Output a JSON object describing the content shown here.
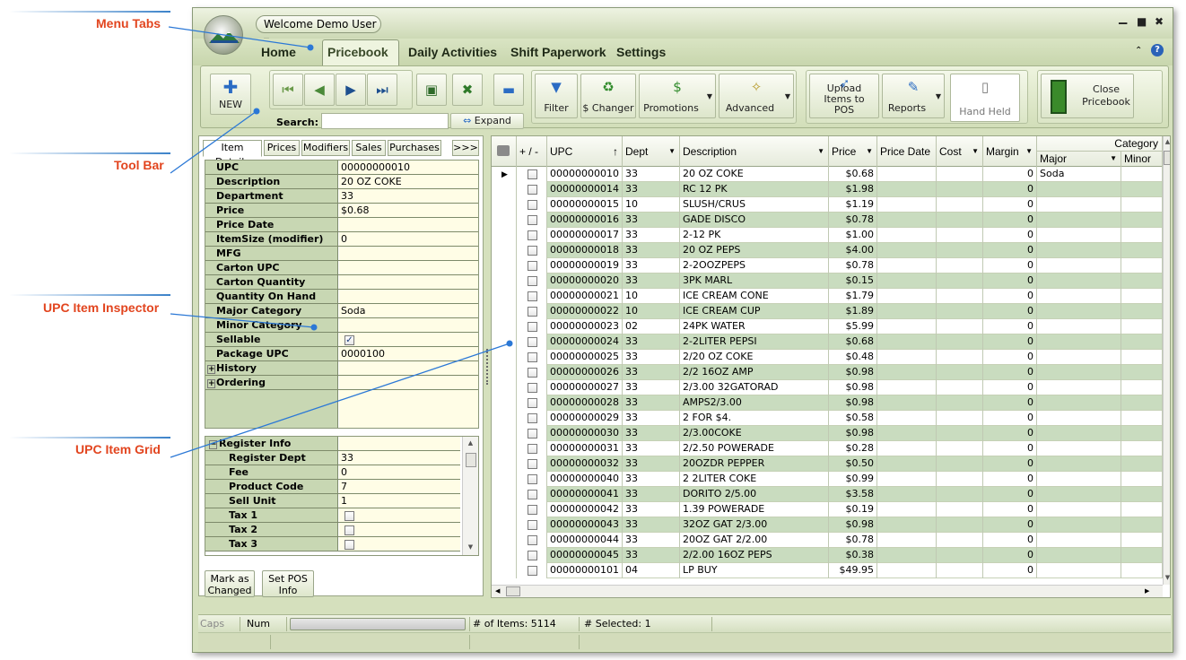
{
  "callouts": {
    "menu_tabs": "Menu Tabs",
    "tool_bar": "Tool Bar",
    "upc_item_inspector": "UPC Item Inspector",
    "upc_item_grid": "UPC Item Grid"
  },
  "titlebar": {
    "user_menu": "Welcome Demo User ▾",
    "minimize": "▁",
    "maximize": "■",
    "close": "✖"
  },
  "menu_tabs": [
    "Home",
    "Pricebook",
    "Daily Activities",
    "Shift Paperwork",
    "Settings"
  ],
  "toolbar": {
    "new": "NEW",
    "search_label": "Search:",
    "search_value": "",
    "expand": "Expand",
    "filter": "Filter",
    "changer": "$ Changer",
    "promotions": "Promotions",
    "advanced": "Advanced",
    "upload": "Upload Items to POS",
    "reports": "Reports",
    "hand_held": "Hand Held",
    "close_pricebook": "Close Pricebook"
  },
  "left_tabs": [
    "Item Details",
    "Prices",
    "Modifiers",
    "Sales",
    "Purchases",
    ">>>"
  ],
  "details": [
    {
      "label": "UPC",
      "value": "00000000010"
    },
    {
      "label": "Description",
      "value": "20 OZ COKE"
    },
    {
      "label": "Department",
      "value": "33"
    },
    {
      "label": "Price",
      "value": "$0.68"
    },
    {
      "label": "Price Date",
      "value": ""
    },
    {
      "label": "ItemSize (modifier)",
      "value": "0"
    },
    {
      "label": "MFG",
      "value": ""
    },
    {
      "label": "Carton UPC",
      "value": ""
    },
    {
      "label": "Carton Quantity",
      "value": ""
    },
    {
      "label": "Quantity On Hand",
      "value": ""
    },
    {
      "label": "Major Category",
      "value": "Soda"
    },
    {
      "label": "Minor Category",
      "value": ""
    },
    {
      "label": "Sellable",
      "value": ""
    },
    {
      "label": "Package UPC",
      "value": "0000100"
    },
    {
      "label": "History",
      "value": ""
    },
    {
      "label": "Ordering",
      "value": ""
    }
  ],
  "register": {
    "header": "Register Info",
    "rows": [
      {
        "label": "Register Dept",
        "value": "33"
      },
      {
        "label": "Fee",
        "value": "0"
      },
      {
        "label": "Product Code",
        "value": "7"
      },
      {
        "label": "Sell Unit",
        "value": "1"
      },
      {
        "label": "Tax 1",
        "value": ""
      },
      {
        "label": "Tax 2",
        "value": ""
      },
      {
        "label": "Tax 3",
        "value": ""
      }
    ]
  },
  "buttons": {
    "mark_changed": "Mark as Changed",
    "set_pos": "Set POS Info"
  },
  "grid": {
    "columns": {
      "plusminus": "+ / -",
      "upc": "UPC",
      "dept": "Dept",
      "description": "Description",
      "price": "Price",
      "price_date": "Price Date",
      "cost": "Cost",
      "margin": "Margin",
      "category": "Category",
      "major": "Major",
      "minor": "Minor"
    },
    "rows": [
      {
        "upc": "00000000010",
        "dept": "33",
        "desc": "20 OZ COKE",
        "price": "$0.68",
        "margin": "0",
        "major": "Soda"
      },
      {
        "upc": "00000000014",
        "dept": "33",
        "desc": "RC 12 PK",
        "price": "$1.98",
        "margin": "0",
        "major": ""
      },
      {
        "upc": "00000000015",
        "dept": "10",
        "desc": "SLUSH/CRUS",
        "price": "$1.19",
        "margin": "0",
        "major": ""
      },
      {
        "upc": "00000000016",
        "dept": "33",
        "desc": "GADE DISCO",
        "price": "$0.78",
        "margin": "0",
        "major": ""
      },
      {
        "upc": "00000000017",
        "dept": "33",
        "desc": "2-12 PK",
        "price": "$1.00",
        "margin": "0",
        "major": ""
      },
      {
        "upc": "00000000018",
        "dept": "33",
        "desc": "20 OZ PEPS",
        "price": "$4.00",
        "margin": "0",
        "major": ""
      },
      {
        "upc": "00000000019",
        "dept": "33",
        "desc": "2-2OOZPEPS",
        "price": "$0.78",
        "margin": "0",
        "major": ""
      },
      {
        "upc": "00000000020",
        "dept": "33",
        "desc": "3PK MARL",
        "price": "$0.15",
        "margin": "0",
        "major": ""
      },
      {
        "upc": "00000000021",
        "dept": "10",
        "desc": "ICE CREAM CONE",
        "price": "$1.79",
        "margin": "0",
        "major": ""
      },
      {
        "upc": "00000000022",
        "dept": "10",
        "desc": "ICE CREAM CUP",
        "price": "$1.89",
        "margin": "0",
        "major": ""
      },
      {
        "upc": "00000000023",
        "dept": "02",
        "desc": "24PK WATER",
        "price": "$5.99",
        "margin": "0",
        "major": ""
      },
      {
        "upc": "00000000024",
        "dept": "33",
        "desc": "2-2LITER PEPSI",
        "price": "$0.68",
        "margin": "0",
        "major": ""
      },
      {
        "upc": "00000000025",
        "dept": "33",
        "desc": "2/20 OZ COKE",
        "price": "$0.48",
        "margin": "0",
        "major": ""
      },
      {
        "upc": "00000000026",
        "dept": "33",
        "desc": "2/2 16OZ AMP",
        "price": "$0.98",
        "margin": "0",
        "major": ""
      },
      {
        "upc": "00000000027",
        "dept": "33",
        "desc": "2/3.00 32GATORAD",
        "price": "$0.98",
        "margin": "0",
        "major": ""
      },
      {
        "upc": "00000000028",
        "dept": "33",
        "desc": "AMPS2/3.00",
        "price": "$0.98",
        "margin": "0",
        "major": ""
      },
      {
        "upc": "00000000029",
        "dept": "33",
        "desc": "2 FOR $4.",
        "price": "$0.58",
        "margin": "0",
        "major": ""
      },
      {
        "upc": "00000000030",
        "dept": "33",
        "desc": "2/3.00COKE",
        "price": "$0.98",
        "margin": "0",
        "major": ""
      },
      {
        "upc": "00000000031",
        "dept": "33",
        "desc": "2/2.50 POWERADE",
        "price": "$0.28",
        "margin": "0",
        "major": ""
      },
      {
        "upc": "00000000032",
        "dept": "33",
        "desc": "20OZDR PEPPER",
        "price": "$0.50",
        "margin": "0",
        "major": ""
      },
      {
        "upc": "00000000040",
        "dept": "33",
        "desc": "2 2LITER COKE",
        "price": "$0.99",
        "margin": "0",
        "major": ""
      },
      {
        "upc": "00000000041",
        "dept": "33",
        "desc": "DORITO 2/5.00",
        "price": "$3.58",
        "margin": "0",
        "major": ""
      },
      {
        "upc": "00000000042",
        "dept": "33",
        "desc": "1.39 POWERADE",
        "price": "$0.19",
        "margin": "0",
        "major": ""
      },
      {
        "upc": "00000000043",
        "dept": "33",
        "desc": "32OZ GAT 2/3.00",
        "price": "$0.98",
        "margin": "0",
        "major": ""
      },
      {
        "upc": "00000000044",
        "dept": "33",
        "desc": "20OZ GAT 2/2.00",
        "price": "$0.78",
        "margin": "0",
        "major": ""
      },
      {
        "upc": "00000000045",
        "dept": "33",
        "desc": "2/2.00 16OZ PEPS",
        "price": "$0.38",
        "margin": "0",
        "major": ""
      },
      {
        "upc": "00000000101",
        "dept": "04",
        "desc": "LP BUY",
        "price": "$49.95",
        "margin": "0",
        "major": ""
      }
    ]
  },
  "status": {
    "caps": "Caps",
    "num": "Num",
    "items": "# of Items: 5114",
    "selected": "# Selected: 1"
  }
}
